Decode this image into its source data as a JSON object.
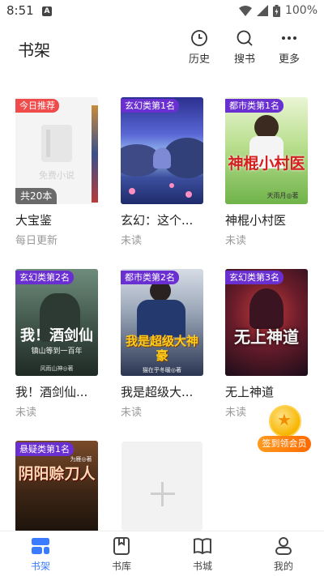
{
  "status_bar": {
    "time": "8:51",
    "notification_icon": "A",
    "battery": "100%"
  },
  "header": {
    "title": "书架",
    "actions": [
      {
        "label": "历史",
        "icon": "clock-icon"
      },
      {
        "label": "搜书",
        "icon": "search-icon"
      },
      {
        "label": "更多",
        "icon": "more-icon"
      }
    ]
  },
  "books": [
    {
      "title": "大宝鉴",
      "status": "每日更新",
      "badge": "今日推荐",
      "badge_color": "#f04b4b",
      "count": "共20本",
      "placeholder": "免费小说"
    },
    {
      "title": "玄幻：这个...",
      "status": "未读",
      "badge": "玄幻类第1名",
      "badge_color": "#6a2fd1"
    },
    {
      "title": "神棍小村医",
      "status": "未读",
      "badge": "都市类第1名",
      "badge_color": "#6a2fd1",
      "cover_title": "神棍小村医",
      "cover_author": "天雨月◎著"
    },
    {
      "title": "我！酒剑仙...",
      "status": "未读",
      "badge": "玄幻类第2名",
      "badge_color": "#6a2fd1",
      "cover_title": "我！酒剑仙",
      "cover_subtitle": "镇山等到一百年",
      "cover_author": "风雨山神◎著"
    },
    {
      "title": "我是超级大...",
      "status": "未读",
      "badge": "都市类第2名",
      "badge_color": "#6a2fd1",
      "cover_title": "我是超级大神豪",
      "cover_author": "猫在乎冬暖◎著"
    },
    {
      "title": "无上神道",
      "status": "未读",
      "badge": "玄幻类第3名",
      "badge_color": "#6a2fd1",
      "cover_title": "无上神道"
    },
    {
      "title": "",
      "status": "",
      "badge": "悬疑类第1名",
      "badge_color": "#6a2fd1",
      "cover_title": "阴阳赊刀人",
      "cover_author": "为雁◎著"
    }
  ],
  "signin": {
    "label": "签到领会员",
    "icon": "star-coin-icon"
  },
  "bottom_nav": [
    {
      "label": "书架",
      "icon": "bookshelf-icon",
      "active": true
    },
    {
      "label": "书库",
      "icon": "library-icon",
      "active": false
    },
    {
      "label": "书城",
      "icon": "bookstore-icon",
      "active": false
    },
    {
      "label": "我的",
      "icon": "profile-icon",
      "active": false
    }
  ],
  "colors": {
    "accent": "#3a7bff",
    "rank_badge": "#6a2fd1",
    "recommend_badge": "#f04b4b",
    "muted_text": "#999999"
  }
}
